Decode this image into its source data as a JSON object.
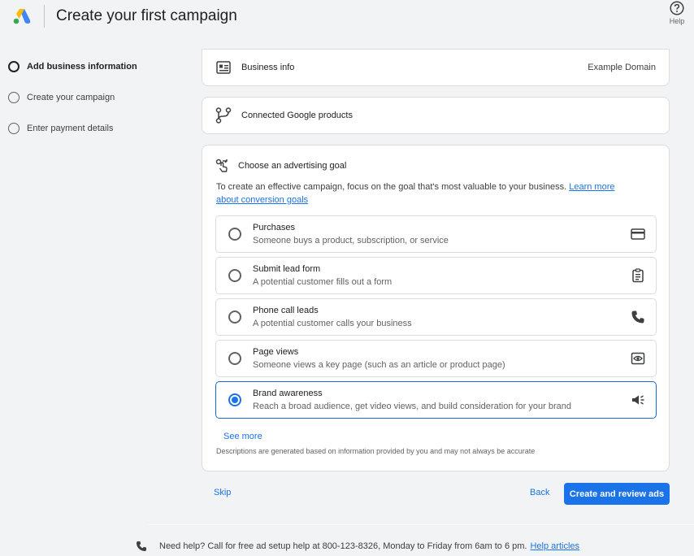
{
  "header": {
    "title": "Create your first campaign",
    "help_label": "Help",
    "logo_icon": "google-ads-logo"
  },
  "steps": [
    {
      "label": "Add business information",
      "active": true
    },
    {
      "label": "Create your campaign",
      "active": false
    },
    {
      "label": "Enter payment details",
      "active": false
    }
  ],
  "business_card": {
    "title": "Business info",
    "value": "Example Domain",
    "icon": "business-card-icon"
  },
  "products_card": {
    "title": "Connected Google products",
    "icon": "connected-products-icon"
  },
  "goal": {
    "title": "Choose an advertising goal",
    "description": "To create an effective campaign, focus on the goal that's most valuable to your business.",
    "link_line1": "Learn more",
    "link_line2": "about conversion goals",
    "options": [
      {
        "title": "Purchases",
        "description": "Someone buys a product, subscription, or service",
        "icon": "credit-card-icon",
        "selected": false
      },
      {
        "title": "Submit lead form",
        "description": "A potential customer fills out a form",
        "icon": "clipboard-icon",
        "selected": false
      },
      {
        "title": "Phone call leads",
        "description": "A potential customer calls your business",
        "icon": "phone-icon",
        "selected": false
      },
      {
        "title": "Page views",
        "description": "Someone views a key page (such as an article or product page)",
        "icon": "page-view-icon",
        "selected": false
      },
      {
        "title": "Brand awareness",
        "description": "Reach a broad audience, get video views, and build consideration for your brand",
        "icon": "megaphone-icon",
        "selected": true
      }
    ],
    "see_more": "See more",
    "disclaimer": "Descriptions are generated based on information provided by you and may not always be accurate"
  },
  "actions": {
    "skip": "Skip",
    "back": "Back",
    "primary": "Create and review ads"
  },
  "footer": {
    "text": "Need help? Call for free ad setup help at 800-123-8326, Monday to Friday from 6am to 6 pm.",
    "link": "Help articles"
  },
  "colors": {
    "accent": "#1a73e8",
    "background": "#f1f3f4"
  }
}
